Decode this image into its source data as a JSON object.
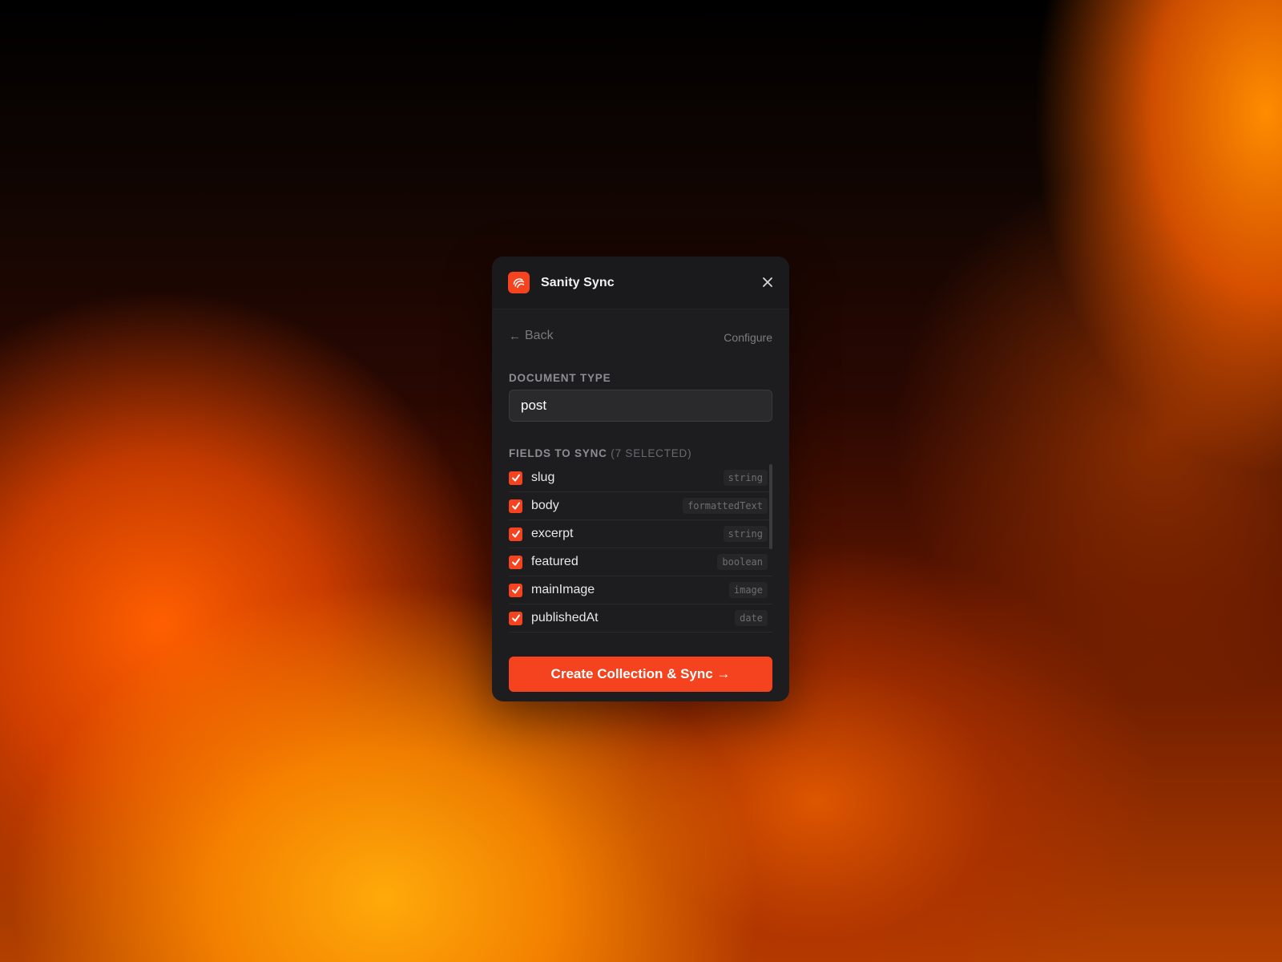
{
  "window": {
    "title": "Sanity Sync",
    "app_icon": "sanity-logo-icon",
    "close_icon": "close-icon"
  },
  "nav": {
    "back_label": "Back",
    "back_icon": "arrow-left-icon",
    "step_label": "Configure"
  },
  "document_type": {
    "label": "DOCUMENT TYPE",
    "value": "post"
  },
  "fields": {
    "label": "FIELDS TO SYNC",
    "count_text": "(7 SELECTED)",
    "items": [
      {
        "name": "slug",
        "type": "string",
        "checked": true
      },
      {
        "name": "body",
        "type": "formattedText",
        "checked": true
      },
      {
        "name": "excerpt",
        "type": "string",
        "checked": true
      },
      {
        "name": "featured",
        "type": "boolean",
        "checked": true
      },
      {
        "name": "mainImage",
        "type": "image",
        "checked": true
      },
      {
        "name": "publishedAt",
        "type": "date",
        "checked": true
      }
    ]
  },
  "primary_action": {
    "label": "Create Collection & Sync →"
  },
  "colors": {
    "accent": "#f4431e",
    "panel_bg": "#1d1d1f"
  }
}
